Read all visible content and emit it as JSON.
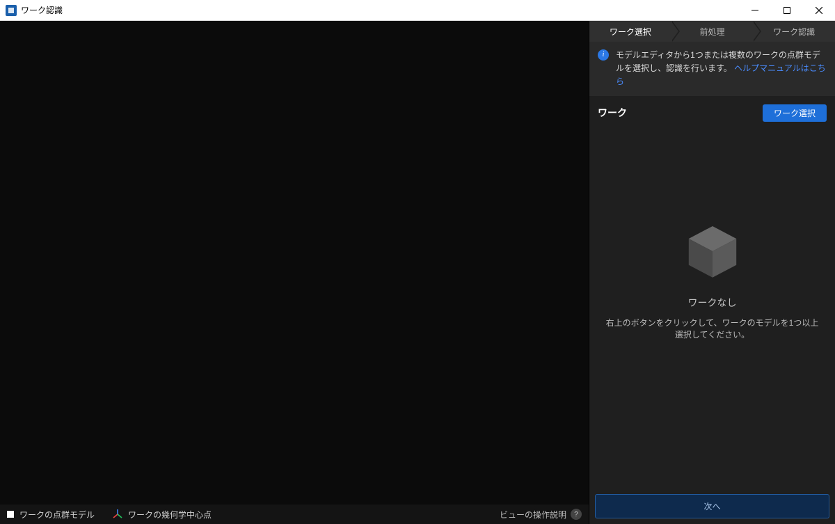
{
  "window": {
    "title": "ワーク認識"
  },
  "steps": {
    "s1": "ワーク選択",
    "s2": "前処理",
    "s3": "ワーク認識"
  },
  "info": {
    "text_prefix": "モデルエディタから1つまたは複数のワークの点群モデルを選択し、認識を行います。",
    "link": "ヘルプマニュアルはこちら"
  },
  "section": {
    "title": "ワーク",
    "select_btn": "ワーク選択"
  },
  "empty": {
    "title": "ワークなし",
    "desc": "右上のボタンをクリックして、ワークのモデルを1つ以上選択してください。"
  },
  "footer": {
    "next": "次へ"
  },
  "status": {
    "pointcloud": "ワークの点群モデル",
    "centroid": "ワークの幾何学中心点",
    "view_help": "ビューの操作説明"
  }
}
